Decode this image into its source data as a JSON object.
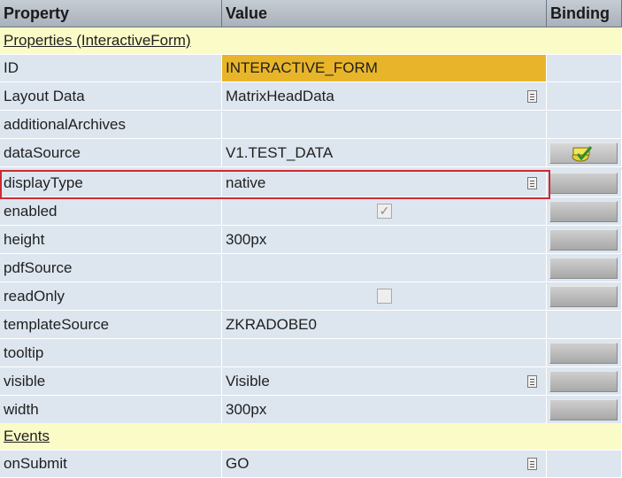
{
  "header": {
    "property": "Property",
    "value": "Value",
    "binding": "Binding"
  },
  "groups": {
    "properties": "Properties (InteractiveForm)",
    "events": "Events"
  },
  "rows": [
    {
      "property": "ID",
      "value": "INTERACTIVE_FORM"
    },
    {
      "property": "Layout Data",
      "value": "MatrixHeadData"
    },
    {
      "property": "additionalArchives",
      "value": ""
    },
    {
      "property": "dataSource",
      "value": "V1.TEST_DATA"
    },
    {
      "property": "displayType",
      "value": "native"
    },
    {
      "property": "enabled",
      "value": ""
    },
    {
      "property": "height",
      "value": "300px"
    },
    {
      "property": "pdfSource",
      "value": ""
    },
    {
      "property": "readOnly",
      "value": ""
    },
    {
      "property": "templateSource",
      "value": "ZKRADOBE0"
    },
    {
      "property": "tooltip",
      "value": ""
    },
    {
      "property": "visible",
      "value": "Visible"
    },
    {
      "property": "width",
      "value": "300px"
    }
  ],
  "event_rows": [
    {
      "property": "onSubmit",
      "value": "GO"
    }
  ],
  "checkboxes": {
    "enabled_checked": true,
    "readOnly_checked": false
  },
  "selected_row": "displayType",
  "colors": {
    "header_bg": "#b4bcc5",
    "group_bg": "#fbfbc8",
    "row_bg": "#dde6ef",
    "id_value_bg": "#e8b52a",
    "selection_border": "#cc2a33"
  },
  "icons": {
    "dropdown": "value-help-icon",
    "binding": "binding-button",
    "bound": "bound-binding-icon",
    "checkbox": "checkbox-icon"
  }
}
